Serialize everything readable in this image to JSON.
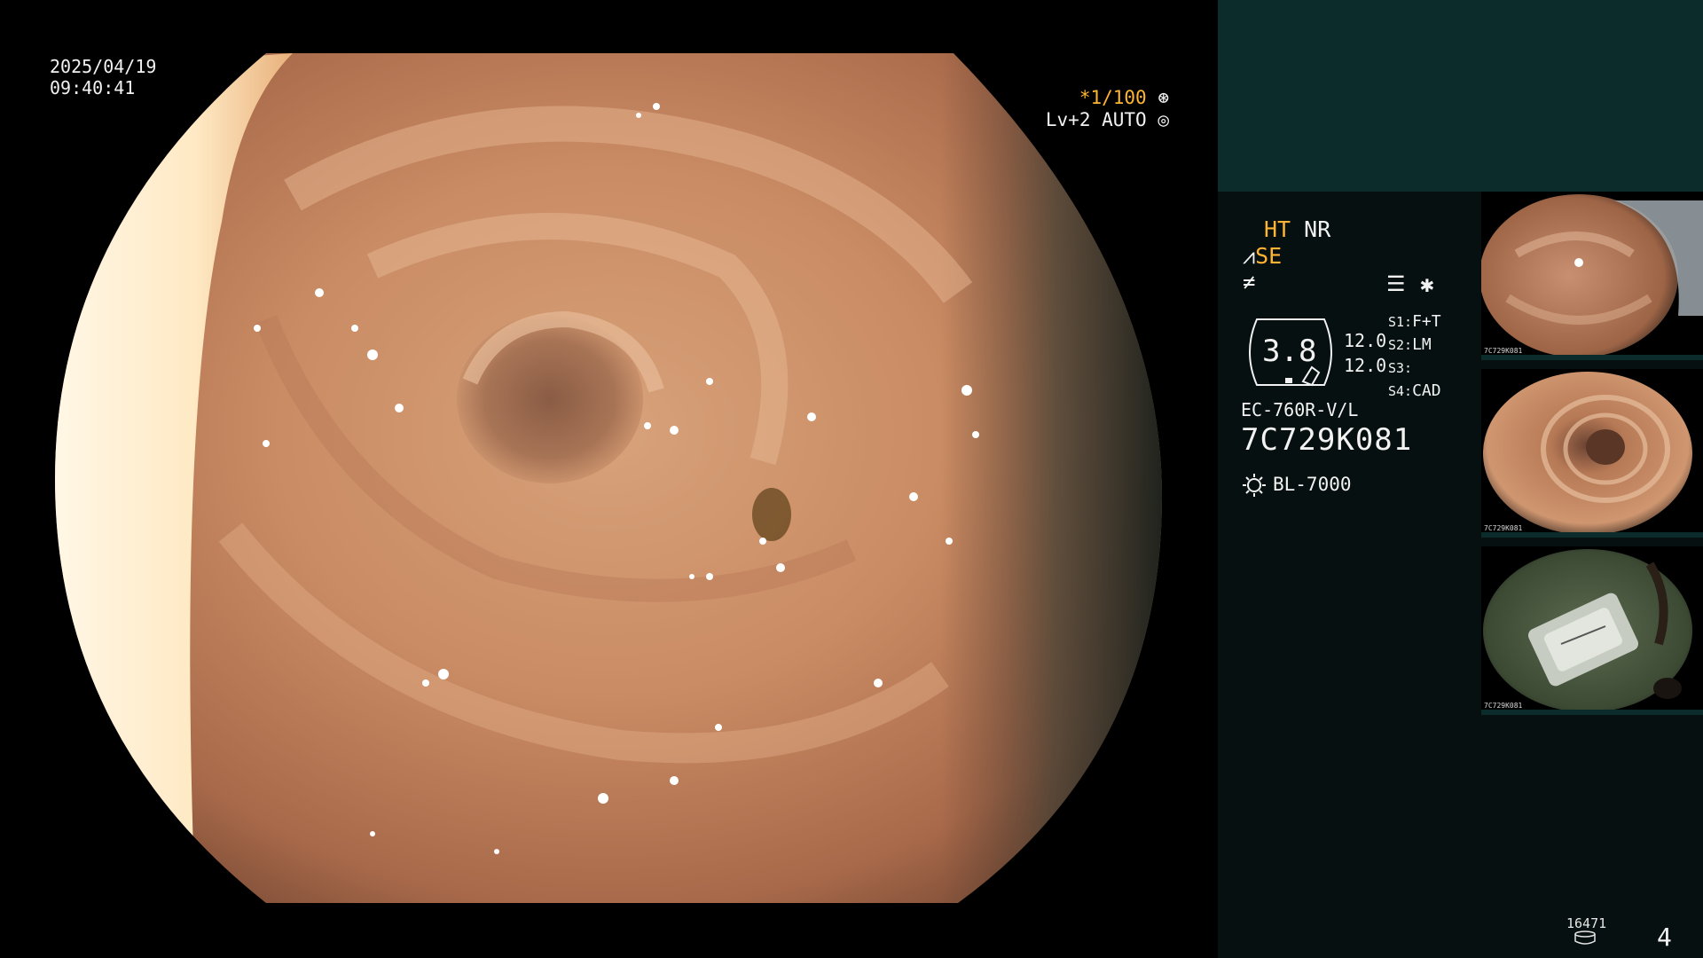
{
  "overlay": {
    "date": "2025/04/19",
    "time": "09:40:41",
    "shutter": "*1/100",
    "iris": "Lv+2 AUTO"
  },
  "panel": {
    "mode_ht": "HT",
    "mode_nr": "NR",
    "mode_se": "SE",
    "gauge_value": "3.8",
    "value_a": "12.0",
    "value_b": "12.0",
    "switches": [
      {
        "key": "S1:",
        "value": "F+T"
      },
      {
        "key": "S2:",
        "value": "LM"
      },
      {
        "key": "S3:",
        "value": ""
      },
      {
        "key": "S4:",
        "value": "CAD"
      }
    ],
    "scope_model": "EC-760R-V/L",
    "scope_serial": "7C729K081",
    "light_source": "BL-7000",
    "thumbnails": [
      {
        "caption": "7C729K081"
      },
      {
        "caption": "7C729K081"
      },
      {
        "caption": "7C729K081"
      }
    ]
  },
  "footer": {
    "counter": "16471",
    "page": "4"
  },
  "colors": {
    "accent_amber": "#ffb533",
    "panel_top": "#0c2b2b",
    "panel_bg": "#061010",
    "tissue": "#c98b63"
  },
  "icons": [
    "shutter-aperture-icon",
    "iris-auto-icon",
    "structure-enhance-icon",
    "color-mode-icon",
    "menu-icon",
    "scope-gauge-icon",
    "light-source-icon",
    "disk-icon"
  ]
}
